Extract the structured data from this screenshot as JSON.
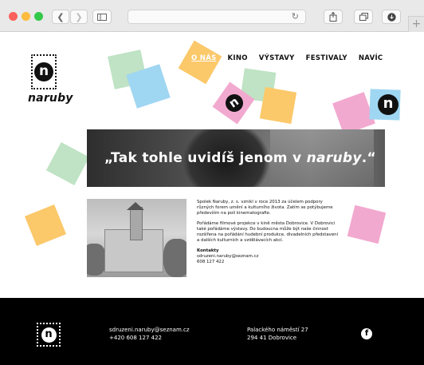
{
  "browser": {
    "traffic_lights": [
      "#fc605c",
      "#fdbc40",
      "#34c84a"
    ],
    "back_icon": "chevron-left",
    "forward_icon": "chevron-right",
    "sidebar_icon": "sidebar",
    "reload_icon": "reload",
    "share_icon": "share",
    "tabs_icon": "tabs",
    "download_icon": "download",
    "new_tab_icon": "plus"
  },
  "site": {
    "logo_letter": "n",
    "logo_text": "naruby"
  },
  "nav": {
    "items": [
      "O NÁS",
      "KINO",
      "VÝSTAVY",
      "FESTIVALY",
      "NAVÍC"
    ]
  },
  "hero": {
    "title_start": "„Tak tohle uvidíš jenom v ",
    "title_em": "naruby",
    "title_end": ".“"
  },
  "about": {
    "p1": "Spolek Naruby, z. s. vznikl v roce 2013 za účelem podpory různých forem umění a kulturního života. Zatím se potýbujeme především na poli kinematografie.",
    "p2": "Pořádáme filmové projekce v kině města Dobrovice. V Dobrovici také pořádáme výstavy. Do budoucna může být naše činnost rozšířena na pořádání hudební produkce, divadelních představení a dalších kulturních a vzdělávacích akcí.",
    "contact_heading": "Kontakty",
    "contact_email": "sdruzeni.naruby@seznam.cz",
    "contact_phone": "608 127 422"
  },
  "footer": {
    "email": "sdruzeni.naruby@seznam.cz",
    "phone": "+420 608 127 422",
    "address_line1": "Palackého náměstí 27",
    "address_line2": "294 41 Dobrovice",
    "facebook_icon": "f"
  },
  "colors": {
    "stamp_green": "#bfe3c4",
    "stamp_blue": "#9fd6f2",
    "stamp_orange": "#fbc86a",
    "stamp_pink": "#f2a9cf",
    "footer_bg": "#000000"
  }
}
